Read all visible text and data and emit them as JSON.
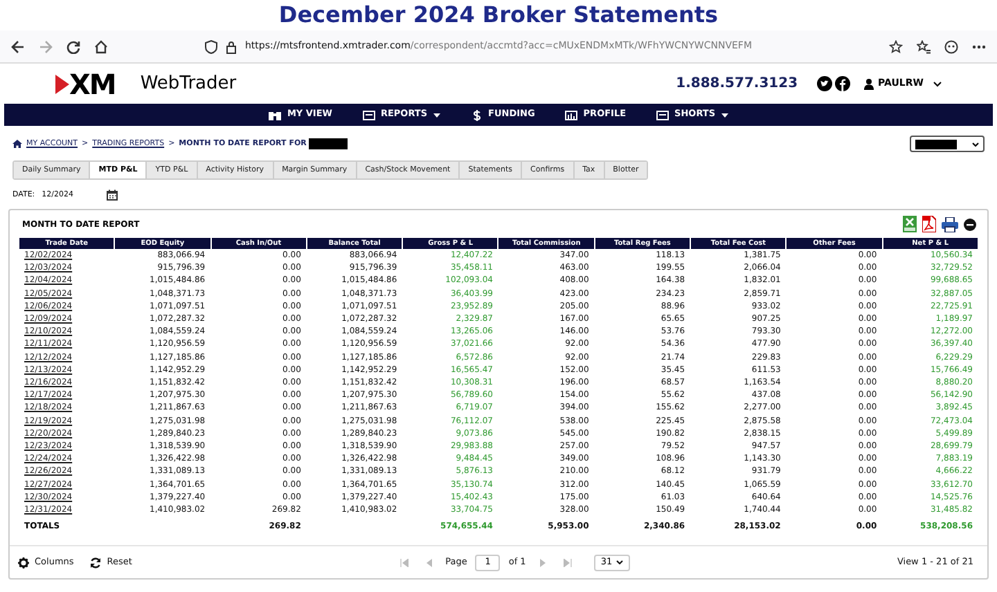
{
  "page_title": "December 2024 Broker Statements",
  "browser": {
    "url_host": "https://mtsfrontend.xmtrader.com",
    "url_path": "/correspondent/accmtd?acc=cMUxENDMxMTk/WFhYWCNYWCNNVEFM"
  },
  "header": {
    "brand": "XM",
    "product": "WebTrader",
    "phone": "1.888.577.3123",
    "user": "PAULRW"
  },
  "nav": [
    {
      "label": "MY VIEW",
      "dropdown": false
    },
    {
      "label": "REPORTS",
      "dropdown": true
    },
    {
      "label": "FUNDING",
      "dropdown": false
    },
    {
      "label": "PROFILE",
      "dropdown": false
    },
    {
      "label": "SHORTS",
      "dropdown": true
    }
  ],
  "breadcrumb": [
    {
      "label": "MY ACCOUNT",
      "kind": "link"
    },
    {
      "label": ">",
      "kind": "sep"
    },
    {
      "label": "TRADING REPORTS",
      "kind": "link"
    },
    {
      "label": ">",
      "kind": "sep"
    },
    {
      "label": "MONTH TO DATE REPORT FOR",
      "kind": "current"
    }
  ],
  "tabs": [
    {
      "label": "Daily Summary",
      "selected": false
    },
    {
      "label": "MTD P&L",
      "selected": true
    },
    {
      "label": "YTD P&L",
      "selected": false
    },
    {
      "label": "Activity History",
      "selected": false
    },
    {
      "label": "Margin Summary",
      "selected": false
    },
    {
      "label": "Cash/Stock Movement",
      "selected": false
    },
    {
      "label": "Statements",
      "selected": false
    },
    {
      "label": "Confirms",
      "selected": false
    },
    {
      "label": "Tax",
      "selected": false
    },
    {
      "label": "Blotter",
      "selected": false
    }
  ],
  "date": {
    "label": "DATE:",
    "value": "12/2024"
  },
  "report": {
    "title": "MONTH TO DATE REPORT",
    "columns": [
      {
        "label": "Trade Date",
        "kind": "date"
      },
      {
        "label": "EOD Equity",
        "kind": "num"
      },
      {
        "label": "Cash In/Out",
        "kind": "num"
      },
      {
        "label": "Balance Total",
        "kind": "num"
      },
      {
        "label": "Gross P & L",
        "kind": "pnl"
      },
      {
        "label": "Total Commission",
        "kind": "num"
      },
      {
        "label": "Total Reg Fees",
        "kind": "num"
      },
      {
        "label": "Total Fee Cost",
        "kind": "num"
      },
      {
        "label": "Other Fees",
        "kind": "num"
      },
      {
        "label": "Net P & L",
        "kind": "pnl"
      }
    ],
    "rows": [
      [
        "12/02/2024",
        "883,066.94",
        "0.00",
        "883,066.94",
        "12,407.22",
        "347.00",
        "118.13",
        "1,381.75",
        "0.00",
        "10,560.34"
      ],
      [
        "12/03/2024",
        "915,796.39",
        "0.00",
        "915,796.39",
        "35,458.11",
        "463.00",
        "199.55",
        "2,066.04",
        "0.00",
        "32,729.52"
      ],
      [
        "12/04/2024",
        "1,015,484.86",
        "0.00",
        "1,015,484.86",
        "102,093.04",
        "408.00",
        "164.38",
        "1,832.01",
        "0.00",
        "99,688.65"
      ],
      [
        "12/05/2024",
        "1,048,371.73",
        "0.00",
        "1,048,371.73",
        "36,403.99",
        "423.00",
        "234.23",
        "2,859.71",
        "0.00",
        "32,887.05"
      ],
      [
        "12/06/2024",
        "1,071,097.51",
        "0.00",
        "1,071,097.51",
        "23,952.89",
        "205.00",
        "88.96",
        "933.02",
        "0.00",
        "22,725.91"
      ],
      [
        "12/09/2024",
        "1,072,287.32",
        "0.00",
        "1,072,287.32",
        "2,329.87",
        "167.00",
        "65.65",
        "907.25",
        "0.00",
        "1,189.97"
      ],
      [
        "12/10/2024",
        "1,084,559.24",
        "0.00",
        "1,084,559.24",
        "13,265.06",
        "146.00",
        "53.76",
        "793.30",
        "0.00",
        "12,272.00"
      ],
      [
        "12/11/2024",
        "1,120,956.59",
        "0.00",
        "1,120,956.59",
        "37,021.66",
        "92.00",
        "54.36",
        "477.90",
        "0.00",
        "36,397.40"
      ],
      [
        "12/12/2024",
        "1,127,185.86",
        "0.00",
        "1,127,185.86",
        "6,572.86",
        "92.00",
        "21.74",
        "229.83",
        "0.00",
        "6,229.29"
      ],
      [
        "12/13/2024",
        "1,142,952.29",
        "0.00",
        "1,142,952.29",
        "16,565.47",
        "152.00",
        "35.45",
        "611.53",
        "0.00",
        "15,766.49"
      ],
      [
        "12/16/2024",
        "1,151,832.42",
        "0.00",
        "1,151,832.42",
        "10,308.31",
        "196.00",
        "68.57",
        "1,163.54",
        "0.00",
        "8,880.20"
      ],
      [
        "12/17/2024",
        "1,207,975.30",
        "0.00",
        "1,207,975.30",
        "56,789.60",
        "154.00",
        "55.62",
        "437.08",
        "0.00",
        "56,142.90"
      ],
      [
        "12/18/2024",
        "1,211,867.63",
        "0.00",
        "1,211,867.63",
        "6,719.07",
        "394.00",
        "155.62",
        "2,277.00",
        "0.00",
        "3,892.45"
      ],
      [
        "12/19/2024",
        "1,275,031.98",
        "0.00",
        "1,275,031.98",
        "76,112.07",
        "538.00",
        "225.45",
        "2,875.58",
        "0.00",
        "72,473.04"
      ],
      [
        "12/20/2024",
        "1,289,840.23",
        "0.00",
        "1,289,840.23",
        "9,073.86",
        "545.00",
        "190.82",
        "2,838.15",
        "0.00",
        "5,499.89"
      ],
      [
        "12/23/2024",
        "1,318,539.90",
        "0.00",
        "1,318,539.90",
        "29,983.88",
        "257.00",
        "79.52",
        "947.57",
        "0.00",
        "28,699.79"
      ],
      [
        "12/24/2024",
        "1,326,422.98",
        "0.00",
        "1,326,422.98",
        "9,484.45",
        "349.00",
        "108.96",
        "1,143.30",
        "0.00",
        "7,883.19"
      ],
      [
        "12/26/2024",
        "1,331,089.13",
        "0.00",
        "1,331,089.13",
        "5,876.13",
        "210.00",
        "68.12",
        "931.79",
        "0.00",
        "4,666.22"
      ],
      [
        "12/27/2024",
        "1,364,701.65",
        "0.00",
        "1,364,701.65",
        "35,130.74",
        "312.00",
        "140.45",
        "1,065.59",
        "0.00",
        "33,612.70"
      ],
      [
        "12/30/2024",
        "1,379,227.40",
        "0.00",
        "1,379,227.40",
        "15,402.43",
        "175.00",
        "61.03",
        "640.64",
        "0.00",
        "14,525.76"
      ],
      [
        "12/31/2024",
        "1,410,983.02",
        "269.82",
        "1,410,983.02",
        "33,704.75",
        "328.00",
        "150.49",
        "1,740.44",
        "0.00",
        "31,485.82"
      ]
    ],
    "totals": {
      "label": "TOTALS",
      "cash_in_out": "269.82",
      "gross_pnl": "574,655.44",
      "total_commission": "5,953.00",
      "total_reg_fees": "2,340.86",
      "total_fee_cost": "28,153.02",
      "other_fees": "0.00",
      "net_pnl": "538,208.56"
    }
  },
  "footer": {
    "columns_button": "Columns",
    "reset_button": "Reset",
    "page_label": "Page",
    "page": "1",
    "page_of": "of 1",
    "page_size": "31",
    "view": "View 1 - 21 of 21"
  }
}
